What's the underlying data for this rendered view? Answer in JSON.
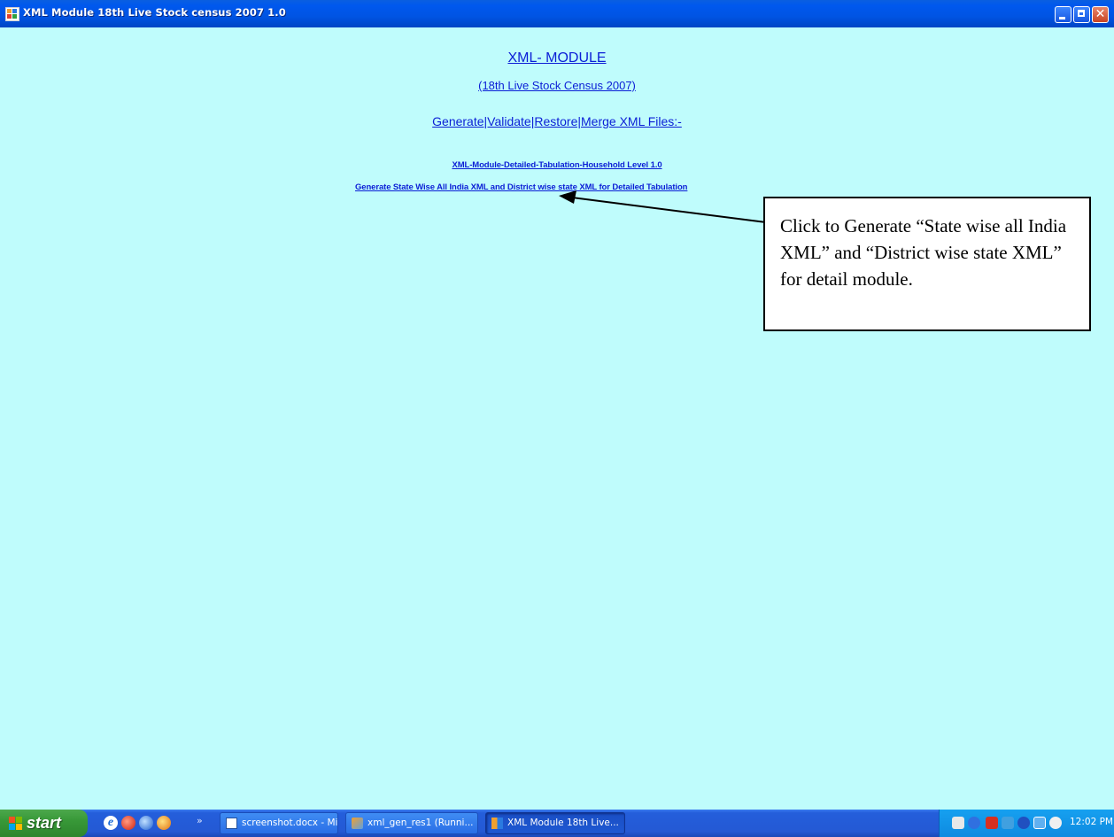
{
  "window": {
    "title": "XML Module 18th Live Stock census 2007 1.0",
    "minimize_label": "_",
    "close_label": "✕"
  },
  "main": {
    "title": "XML- MODULE",
    "subtitle": "(18th Live Stock Census 2007)",
    "actions_line": "Generate|Validate|Restore|Merge XML Files:-",
    "module_link": "XML-Module-Detailed-Tabulation-Household Level 1.0",
    "generate_link": " Generate  State Wise All India XML and District wise state XML for Detailed Tabulation",
    "callout": "Click to Generate “State wise all India XML” and “District wise state XML” for detail module."
  },
  "taskbar": {
    "start_label": "start",
    "quicklaunch_more": "»",
    "tasks": [
      {
        "label": "screenshot.docx - Mi...",
        "icon": "word-document-icon"
      },
      {
        "label": "xml_gen_res1 (Runni...",
        "icon": "virtual-machine-icon"
      },
      {
        "label": "XML Module 18th Live...",
        "icon": "app-window-icon"
      }
    ],
    "clock": "12:02 PM"
  },
  "colors": {
    "background": "#bffcfc",
    "link": "#0b1ed6",
    "titlebar": "#0054e3",
    "taskbar": "#245edb",
    "start": "#389838"
  }
}
